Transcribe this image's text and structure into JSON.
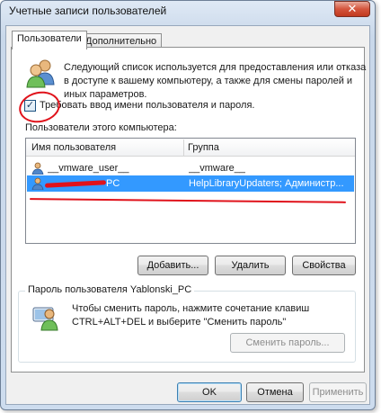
{
  "window": {
    "title": "Учетные записи пользователей",
    "close_label": "✕"
  },
  "tabs": [
    {
      "label": "Пользователи",
      "active": true
    },
    {
      "label": "Дополнительно",
      "active": false
    }
  ],
  "intro": {
    "line1": "Следующий список используется для предоставления или отказа",
    "line2": "в доступе к вашему компьютеру, а также для смены паролей и",
    "line3": "иных параметров."
  },
  "require_login": {
    "checked": true,
    "check_glyph": "✓",
    "label": "Требовать ввод имени пользователя и пароля."
  },
  "users_list": {
    "label": "Пользователи этого компьютера:",
    "columns": [
      "Имя пользователя",
      "Группа"
    ],
    "rows": [
      {
        "name": "__vmware_user__",
        "group": "__vmware__",
        "selected": false
      },
      {
        "name": "PC",
        "group": "HelpLibraryUpdaters; Администр...",
        "selected": true
      }
    ]
  },
  "list_buttons": {
    "add": "Добавить...",
    "remove": "Удалить",
    "properties": "Свойства"
  },
  "password_group": {
    "title": "Пароль пользователя Yablonski_PC",
    "line1": "Чтобы сменить пароль, нажмите сочетание клавиш",
    "line2": "CTRL+ALT+DEL и выберите \"Сменить пароль\"",
    "change_button": "Сменить пароль..."
  },
  "dialog_buttons": {
    "ok": "OK",
    "cancel": "Отмена",
    "apply": "Применить"
  },
  "colors": {
    "selection": "#3399ff",
    "annotation_red": "#e0121b"
  }
}
